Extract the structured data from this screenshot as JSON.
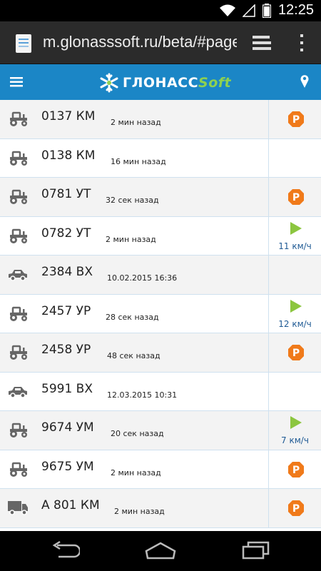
{
  "status_bar": {
    "time": "12:25"
  },
  "browser": {
    "url": "m.glonasssoft.ru/beta/#page"
  },
  "header": {
    "logo_main": "ГЛОНАСС",
    "logo_accent": "Soft",
    "accent_color": "#1b86c6"
  },
  "vehicles": [
    {
      "plate": "0137 КМ",
      "ago": "2 мин назад",
      "type": "tractor",
      "status": "parking",
      "speed": ""
    },
    {
      "plate": "0138 КМ",
      "ago": "16 мин назад",
      "type": "tractor",
      "status": "none",
      "speed": ""
    },
    {
      "plate": "0781 УТ",
      "ago": "32 сек назад",
      "type": "tractor",
      "status": "parking",
      "speed": ""
    },
    {
      "plate": "0782 УТ",
      "ago": "2 мин назад",
      "type": "tractor",
      "status": "moving",
      "speed": "11 км/ч"
    },
    {
      "plate": "2384 ВХ",
      "ago": "10.02.2015 16:36",
      "type": "car",
      "status": "none",
      "speed": ""
    },
    {
      "plate": "2457 УР",
      "ago": "28 сек назад",
      "type": "tractor",
      "status": "moving",
      "speed": "12 км/ч"
    },
    {
      "plate": "2458 УР",
      "ago": "48 сек назад",
      "type": "tractor",
      "status": "parking",
      "speed": ""
    },
    {
      "plate": "5991 ВХ",
      "ago": "12.03.2015 10:31",
      "type": "car",
      "status": "none",
      "speed": ""
    },
    {
      "plate": "9674 УМ",
      "ago": "20 сек назад",
      "type": "tractor",
      "status": "moving",
      "speed": "7 км/ч"
    },
    {
      "plate": "9675 УМ",
      "ago": "2 мин назад",
      "type": "tractor",
      "status": "parking",
      "speed": ""
    },
    {
      "plate": "А 801 КМ",
      "ago": "2 мин назад",
      "type": "truck",
      "status": "parking",
      "speed": ""
    }
  ],
  "colors": {
    "parking": "#f07a1a",
    "moving": "#8cc63f",
    "speed_text": "#1f5a94"
  }
}
